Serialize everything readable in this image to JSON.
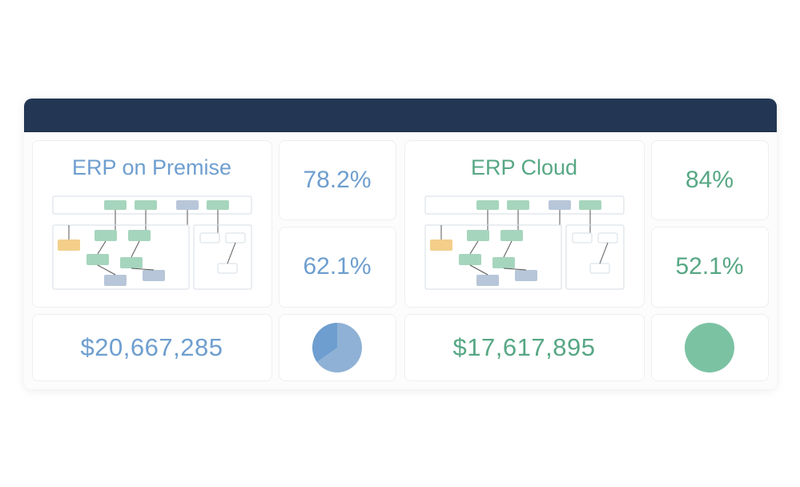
{
  "panels": [
    {
      "title": "ERP on Premise",
      "color_class": "blue",
      "pct_top": "78.2%",
      "pct_bottom": "62.1%",
      "amount": "$20,667,285",
      "pie_class": "pie-blue"
    },
    {
      "title": "ERP Cloud",
      "color_class": "green",
      "pct_top": "84%",
      "pct_bottom": "52.1%",
      "amount": "$17,617,895",
      "pie_class": "pie-green"
    }
  ]
}
